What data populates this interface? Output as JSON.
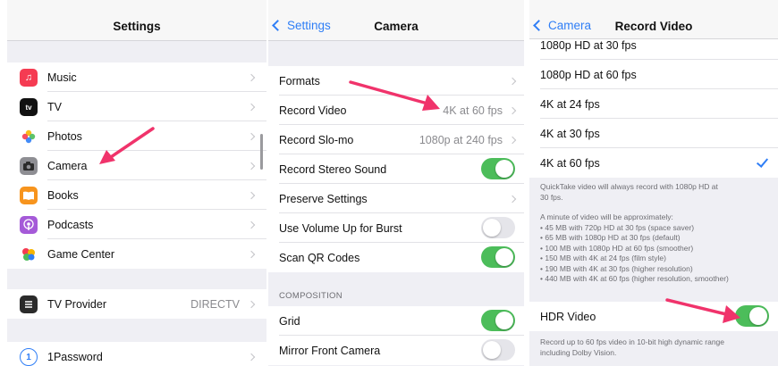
{
  "settings": {
    "title": "Settings",
    "items": [
      {
        "label": "Music",
        "icon": "music-note-icon",
        "color": "#f53b52"
      },
      {
        "label": "TV",
        "icon": "apple-tv-icon",
        "color": "#111111"
      },
      {
        "label": "Photos",
        "icon": "photos-flower-icon",
        "color": "#ffffff"
      },
      {
        "label": "Camera",
        "icon": "camera-icon",
        "color": "#8e8e93"
      },
      {
        "label": "Books",
        "icon": "book-icon",
        "color": "#f7941d"
      },
      {
        "label": "Podcasts",
        "icon": "podcasts-icon",
        "color": "#a55ad8"
      },
      {
        "label": "Game Center",
        "icon": "game-center-icon",
        "color": "#ffffff"
      }
    ],
    "provider": {
      "label": "TV Provider",
      "value": "DIRECTV",
      "icon": "tv-provider-icon",
      "color": "#2b2b2b"
    },
    "onepassword": {
      "label": "1Password",
      "icon": "onepassword-icon",
      "color": "#2f7ef6"
    }
  },
  "camera": {
    "back_label": "Settings",
    "title": "Camera",
    "rows": [
      {
        "label": "Formats"
      },
      {
        "label": "Record Video",
        "value": "4K at 60 fps"
      },
      {
        "label": "Record Slo-mo",
        "value": "1080p at 240 fps"
      },
      {
        "label": "Record Stereo Sound",
        "toggle": "on"
      },
      {
        "label": "Preserve Settings"
      },
      {
        "label": "Use Volume Up for Burst",
        "toggle": "off"
      },
      {
        "label": "Scan QR Codes",
        "toggle": "on"
      }
    ],
    "composition_header": "COMPOSITION",
    "composition_rows": [
      {
        "label": "Grid",
        "toggle": "on"
      },
      {
        "label": "Mirror Front Camera",
        "toggle": "off"
      }
    ]
  },
  "record_video": {
    "back_label": "Camera",
    "title": "Record Video",
    "options": [
      "1080p HD at 30 fps",
      "1080p HD at 60 fps",
      "4K at 24 fps",
      "4K at 30 fps",
      "4K at 60 fps"
    ],
    "selected": "4K at 60 fps",
    "quicktake_note": [
      "QuickTake video will always record with 1080p HD at",
      "30 fps."
    ],
    "size_note": [
      "A minute of video will be approximately:",
      "• 45 MB with 720p HD at 30 fps (space saver)",
      "• 65 MB with 1080p HD at 30 fps (default)",
      "• 100 MB with 1080p HD at 60 fps (smoother)",
      "• 150 MB with 4K at 24 fps (film style)",
      "• 190 MB with 4K at 30 fps (higher resolution)",
      "• 440 MB with 4K at 60 fps (higher resolution, smoother)"
    ],
    "hdr": {
      "label": "HDR Video",
      "toggle": "on"
    },
    "hdr_note": [
      "Record up to 60 fps video in 10-bit high dynamic range",
      "including Dolby Vision."
    ]
  },
  "colors": {
    "accent": "#2f7ef6",
    "toggle_on": "#4cbd5a",
    "arrow": "#f0336b"
  }
}
